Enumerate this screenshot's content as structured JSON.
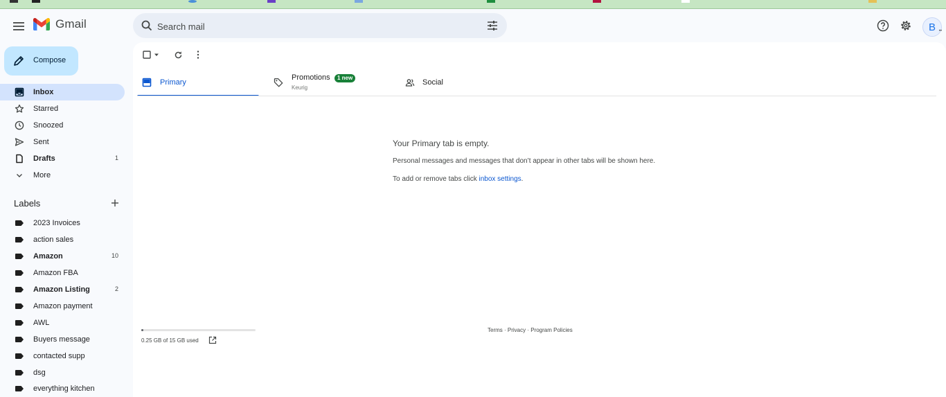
{
  "app": {
    "name": "Gmail"
  },
  "search": {
    "placeholder": "Search mail"
  },
  "account": {
    "initial": "B"
  },
  "compose": {
    "label": "Compose"
  },
  "nav": [
    {
      "label": "Inbox",
      "count": "",
      "icon": "inbox-icon",
      "active": true,
      "bold": true
    },
    {
      "label": "Starred",
      "count": "",
      "icon": "star-icon"
    },
    {
      "label": "Snoozed",
      "count": "",
      "icon": "clock-icon"
    },
    {
      "label": "Sent",
      "count": "",
      "icon": "send-icon"
    },
    {
      "label": "Drafts",
      "count": "1",
      "icon": "draft-icon",
      "bold": true
    },
    {
      "label": "More",
      "count": "",
      "icon": "chevron-down-icon"
    }
  ],
  "labels": {
    "title": "Labels",
    "items": [
      {
        "label": "2023 Invoices",
        "count": ""
      },
      {
        "label": "action sales",
        "count": ""
      },
      {
        "label": "Amazon",
        "count": "10",
        "bold": true
      },
      {
        "label": "Amazon FBA",
        "count": ""
      },
      {
        "label": "Amazon Listing",
        "count": "2",
        "bold": true
      },
      {
        "label": "Amazon payment",
        "count": ""
      },
      {
        "label": "AWL",
        "count": ""
      },
      {
        "label": "Buyers message",
        "count": ""
      },
      {
        "label": "contacted supp",
        "count": ""
      },
      {
        "label": "dsg",
        "count": ""
      },
      {
        "label": "everything kitchen",
        "count": ""
      }
    ]
  },
  "tabs": [
    {
      "label": "Primary",
      "active": true
    },
    {
      "label": "Promotions",
      "badge": "1 new",
      "sub": "Keurig"
    },
    {
      "label": "Social"
    }
  ],
  "empty": {
    "title": "Your Primary tab is empty.",
    "desc": "Personal messages and messages that don’t appear in other tabs will be shown here.",
    "settings_prefix": "To add or remove tabs click ",
    "settings_link": "inbox settings",
    "settings_suffix": "."
  },
  "storage": {
    "text": "0.25 GB of 15 GB used",
    "fraction": 0.017
  },
  "footer": {
    "terms": "Terms",
    "privacy": "Privacy",
    "policies": "Program Policies",
    "sep": " · "
  },
  "colors": {
    "accent": "#0b57d0",
    "compose_bg": "#c2e7ff",
    "active_nav": "#d3e3fd",
    "badge": "#188038",
    "topstrip": "#c6e6c3"
  }
}
